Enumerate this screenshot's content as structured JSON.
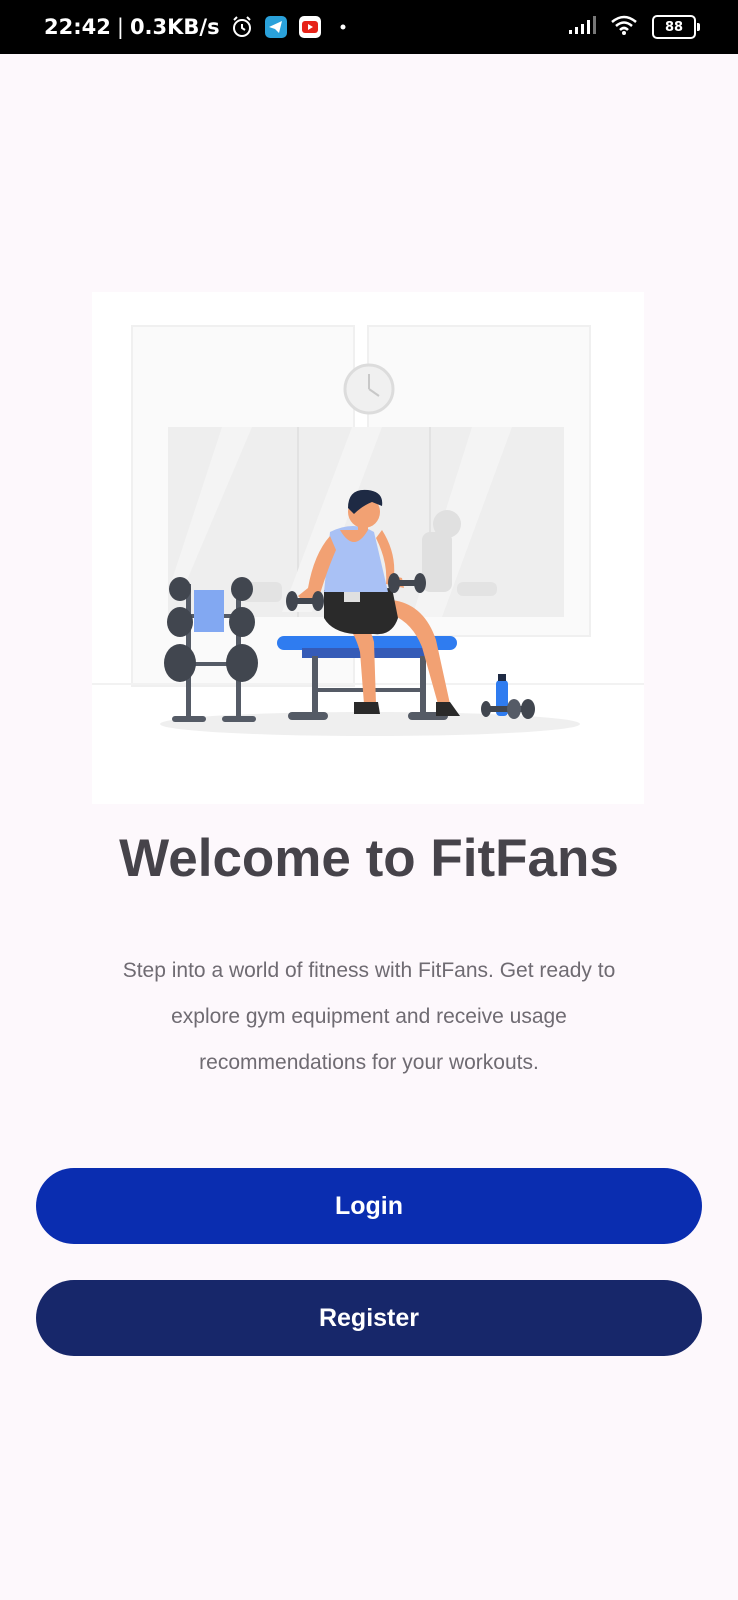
{
  "status_bar": {
    "time": "22:42",
    "separator": "|",
    "network_speed": "0.3KB/s",
    "battery_level": "88",
    "icons": [
      "alarm-icon",
      "telegram-icon",
      "youtube-icon",
      "dot-icon",
      "signal-icon",
      "wifi-icon",
      "battery-icon"
    ]
  },
  "welcome": {
    "title": "Welcome to FitFans",
    "description": "Step into a world of fitness with FitFans. Get ready to explore gym equipment and receive usage recommendations for your workouts."
  },
  "actions": {
    "login_label": "Login",
    "register_label": "Register"
  },
  "colors": {
    "background": "#fdf8fc",
    "login_button": "#0a2db0",
    "register_button": "#17276a",
    "title_text": "#46434a",
    "accent_blue": "#2f7cf0"
  }
}
